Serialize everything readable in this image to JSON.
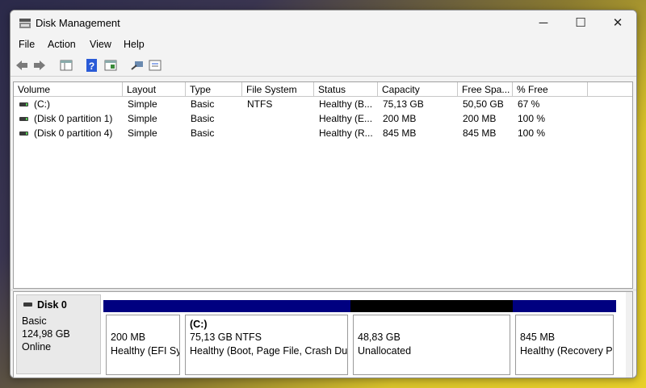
{
  "window": {
    "title": "Disk Management"
  },
  "controls": {
    "minimize": "─",
    "maximize": "☐",
    "close": "✕"
  },
  "menu": [
    "File",
    "Action",
    "View",
    "Help"
  ],
  "toolbar": [
    "back-icon",
    "forward-icon",
    "console-tree-icon",
    "help-icon",
    "properties-icon",
    "rescan-icon",
    "settings-list-icon"
  ],
  "volumes": {
    "columns": [
      "Volume",
      "Layout",
      "Type",
      "File System",
      "Status",
      "Capacity",
      "Free Spa...",
      "% Free"
    ],
    "rows": [
      [
        "(C:)",
        "Simple",
        "Basic",
        "NTFS",
        "Healthy (B...",
        "75,13 GB",
        "50,50 GB",
        "67 %"
      ],
      [
        "(Disk 0 partition 1)",
        "Simple",
        "Basic",
        "",
        "Healthy (E...",
        "200 MB",
        "200 MB",
        "100 %"
      ],
      [
        "(Disk 0 partition 4)",
        "Simple",
        "Basic",
        "",
        "Healthy (R...",
        "845 MB",
        "845 MB",
        "100 %"
      ]
    ]
  },
  "disk": {
    "name": "Disk 0",
    "type": "Basic",
    "size": "124,98 GB",
    "state": "Online",
    "partitions": [
      {
        "title": "",
        "line1": "200 MB",
        "line2": "Healthy (EFI Sy",
        "color": "#000080"
      },
      {
        "title": "(C:)",
        "line1": "75,13 GB NTFS",
        "line2": "Healthy (Boot, Page File, Crash Dun",
        "color": "#000080"
      },
      {
        "title": "",
        "line1": "48,83 GB",
        "line2": "Unallocated",
        "color": "#000000"
      },
      {
        "title": "",
        "line1": "845 MB",
        "line2": "Healthy (Recovery Pa",
        "color": "#000080"
      }
    ]
  }
}
